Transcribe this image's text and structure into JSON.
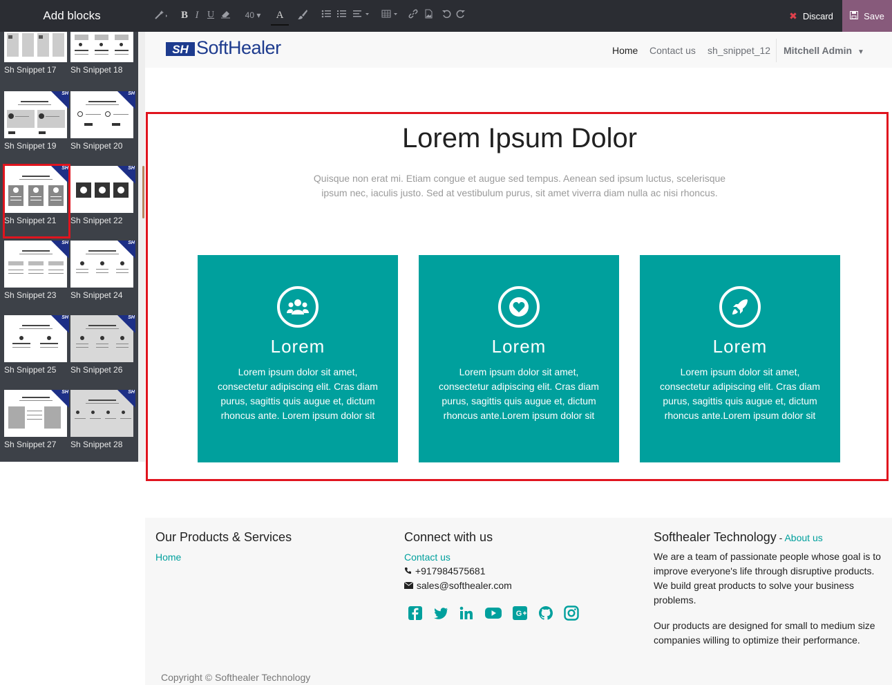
{
  "sidebar": {
    "title": "Add blocks",
    "badge": "SH",
    "snippets": [
      {
        "label": "Sh Snippet 17"
      },
      {
        "label": "Sh Snippet 18"
      },
      {
        "label": "Sh Snippet 19"
      },
      {
        "label": "Sh Snippet 20"
      },
      {
        "label": "Sh Snippet 21",
        "selected": true
      },
      {
        "label": "Sh Snippet 22"
      },
      {
        "label": "Sh Snippet 23"
      },
      {
        "label": "Sh Snippet 24"
      },
      {
        "label": "Sh Snippet 25"
      },
      {
        "label": "Sh Snippet 26"
      },
      {
        "label": "Sh Snippet 27"
      },
      {
        "label": "Sh Snippet 28"
      }
    ]
  },
  "toolbar": {
    "font_size": "40",
    "bold_label": "B",
    "italic_label": "I",
    "underline_label": "U",
    "font_color_label": "A",
    "discard_label": "Discard",
    "save_label": "Save",
    "icons": [
      "magic-wand-icon",
      "bold-icon",
      "italic-icon",
      "underline-icon",
      "eraser-icon",
      "font-size-dropdown",
      "font-color-icon",
      "brush-icon",
      "bullet-list-icon",
      "numbered-list-icon",
      "align-icon",
      "table-icon",
      "link-icon",
      "image-icon",
      "undo-icon",
      "redo-icon"
    ]
  },
  "header": {
    "logo_mark": "SH",
    "logo_text": "SoftHealer",
    "nav": {
      "home": "Home",
      "contact": "Contact us",
      "snippet": "sh_snippet_12"
    },
    "user": "Mitchell Admin"
  },
  "main": {
    "title": "Lorem Ipsum Dolor",
    "subtitle": "Quisque non erat mi. Etiam congue et augue sed tempus. Aenean sed ipsum luctus, scelerisque ipsum nec, iaculis justo. Sed at vestibulum purus, sit amet viverra diam nulla ac nisi rhoncus.",
    "cards": [
      {
        "icon": "users-icon",
        "title": "Lorem",
        "text": "Lorem ipsum dolor sit amet, consectetur adipiscing elit. Cras diam purus, sagittis quis augue et, dictum rhoncus ante. Lorem ipsum dolor sit"
      },
      {
        "icon": "heart-icon",
        "title": "Lorem",
        "text": "Lorem ipsum dolor sit amet, consectetur adipiscing elit. Cras diam purus, sagittis quis augue et, dictum rhoncus ante.Lorem ipsum dolor sit"
      },
      {
        "icon": "rocket-icon",
        "title": "Lorem",
        "text": "Lorem ipsum dolor sit amet, consectetur adipiscing elit. Cras diam purus, sagittis quis augue et, dictum rhoncus ante.Lorem ipsum dolor sit"
      }
    ],
    "card_color": "#00a09d",
    "selection_color": "#e0141e"
  },
  "footer": {
    "products_title": "Our Products & Services",
    "products_link": "Home",
    "connect_title": "Connect with us",
    "connect_link": "Contact us",
    "phone": "+917984575681",
    "email": "sales@softhealer.com",
    "company_title": "Softhealer Technology",
    "company_sep": " - ",
    "about_link": "About us",
    "company_p1": "We are a team of passionate people whose goal is to improve everyone's life through disruptive products. We build great products to solve your business problems.",
    "company_p2": "Our products are designed for small to medium size companies willing to optimize their performance.",
    "social": [
      "facebook-icon",
      "twitter-icon",
      "linkedin-icon",
      "youtube-icon",
      "google-plus-icon",
      "github-icon",
      "instagram-icon"
    ],
    "copyright": "Copyright © Softhealer Technology"
  }
}
